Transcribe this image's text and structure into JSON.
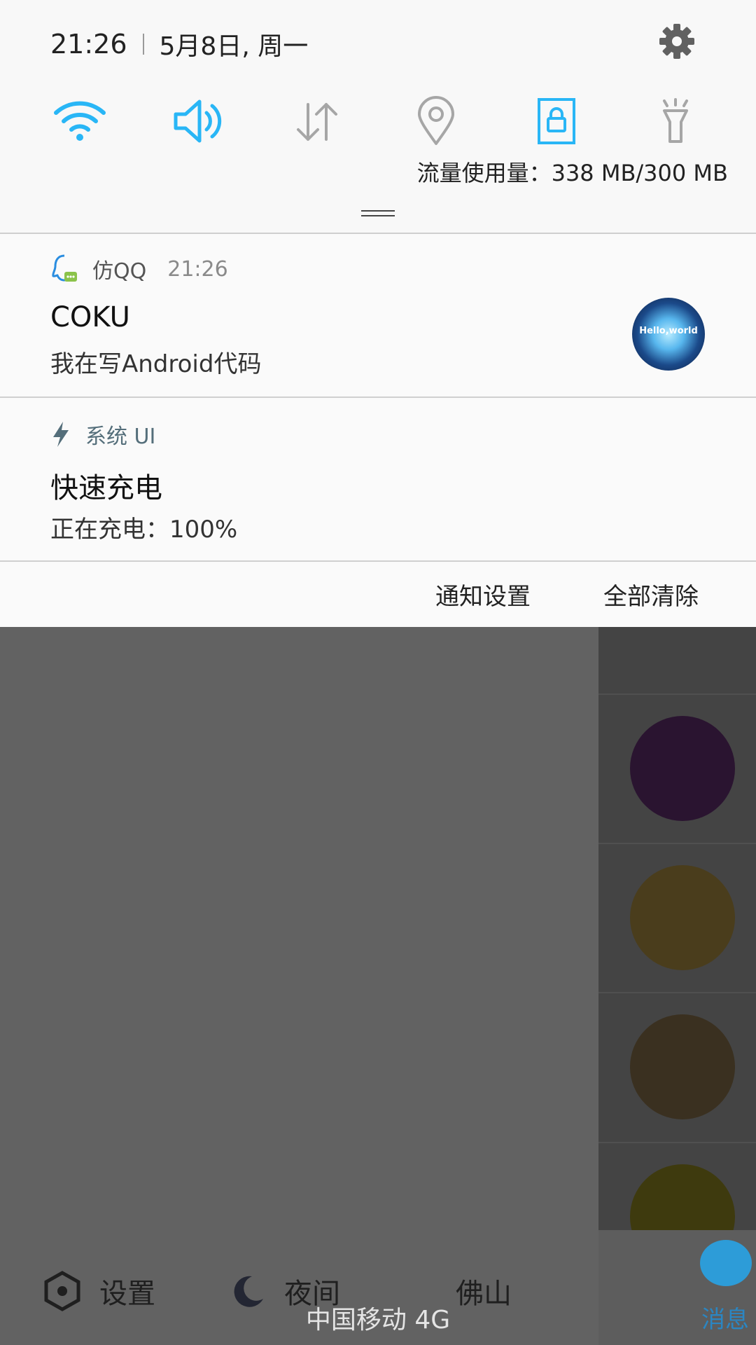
{
  "status_bar": {
    "time": "21:26",
    "date": "5月8日, 周一"
  },
  "quick_settings": {
    "items": [
      {
        "icon": "wifi-icon",
        "active": true
      },
      {
        "icon": "sound-icon",
        "active": true
      },
      {
        "icon": "mobile-data-icon",
        "active": false
      },
      {
        "icon": "location-icon",
        "active": false
      },
      {
        "icon": "screen-lock-icon",
        "active": true
      },
      {
        "icon": "flashlight-icon",
        "active": false
      }
    ],
    "data_usage": "流量使用量：338 MB/300 MB"
  },
  "notifications": [
    {
      "app": "仿QQ",
      "time": "21:26",
      "title": "COKU",
      "text": "我在写Android代码",
      "avatar_text": "Hello,world"
    },
    {
      "app": "系统 UI",
      "title": "快速充电",
      "text": "正在充电：100%"
    }
  ],
  "actions": {
    "settings": "通知设置",
    "clear_all": "全部清除"
  },
  "background_app": {
    "tabs": [
      {
        "label": "设置",
        "icon": "hexagon-settings-icon"
      },
      {
        "label": "夜间",
        "icon": "moon-icon"
      },
      {
        "label": "佛山"
      }
    ],
    "carrier": "中国移动 4G",
    "message_tab": "消息",
    "avatar_colors": [
      "#1f2a55",
      "#2a1430",
      "#4a3d1c",
      "#3a3020",
      "#3e3a0e"
    ]
  },
  "colors": {
    "accent": "#29b6f6",
    "inactive": "#a6a6a6"
  }
}
